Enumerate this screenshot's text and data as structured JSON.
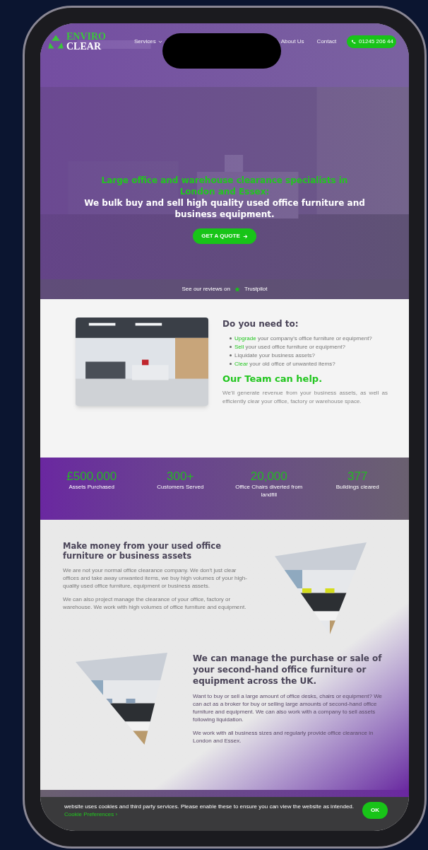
{
  "nav": {
    "logo_top": "ENVIRO",
    "logo_bottom": "CLEAR",
    "items": [
      {
        "label": "Services",
        "dropdown": true
      },
      {
        "label": "About Us",
        "dropdown": false
      },
      {
        "label": "Contact",
        "dropdown": false
      }
    ],
    "phone": "01245 206 44"
  },
  "hero": {
    "headline": "Large office and warehouse clearance specialists in London and Essex:",
    "subheadline": "We bulk buy and sell high quality used office furniture and business equipment.",
    "button": "GET A QUOTE",
    "reviews_text": "See our reviews on",
    "reviews_brand": "Trustpilot"
  },
  "intro": {
    "title": "Do you need to:",
    "items": [
      {
        "highlight": "Upgrade",
        "text": " your company's office furniture or equipment?"
      },
      {
        "highlight": "Sell",
        "text": " your used office furniture or equipment?"
      },
      {
        "text": "Liquidate your business assets?"
      },
      {
        "highlight": "Clear",
        "text": " your old office of unwanted items?"
      }
    ],
    "team_title": "Our Team can help.",
    "team_text": "We'll generate revenue from your business assets, as well as efficiently clear your office, factory or warehouse space."
  },
  "stats": [
    {
      "value": "£500,000",
      "label": "Assets Purchased"
    },
    {
      "value": "300+",
      "label": "Customers Served"
    },
    {
      "value": "20,000",
      "label": "Office Chairs diverted from landfill"
    },
    {
      "value": "377",
      "label": "Buildings cleared"
    }
  ],
  "money": {
    "title": "Make money from your used office furniture or business assets",
    "paragraphs": [
      "We are not your normal office clearance company. We don't just clear offices and take away unwanted items, we buy high volumes of your high-quality used office furniture, equipment or business assets.",
      "We can also project manage the clearance of your office, factory or warehouse. We work with high volumes of office furniture and equipment."
    ]
  },
  "manage": {
    "title": "We can manage the purchase or sale of your second-hand office furniture or equipment across the UK.",
    "paragraphs": [
      "Want to buy or sell a large amount of office desks, chairs or equipment? We can act as a broker for buy or selling large amounts of second-hand office furniture and equipment. We can also work with a company to sell assets following liquidation.",
      "We work with all business sizes and regularly provide office clearance in London and Essex."
    ]
  },
  "cookie": {
    "text": "website uses cookies and third party services. Please enable these to ensure you can view the website as intended.",
    "link": "Cookie Preferences ›",
    "button": "OK"
  }
}
